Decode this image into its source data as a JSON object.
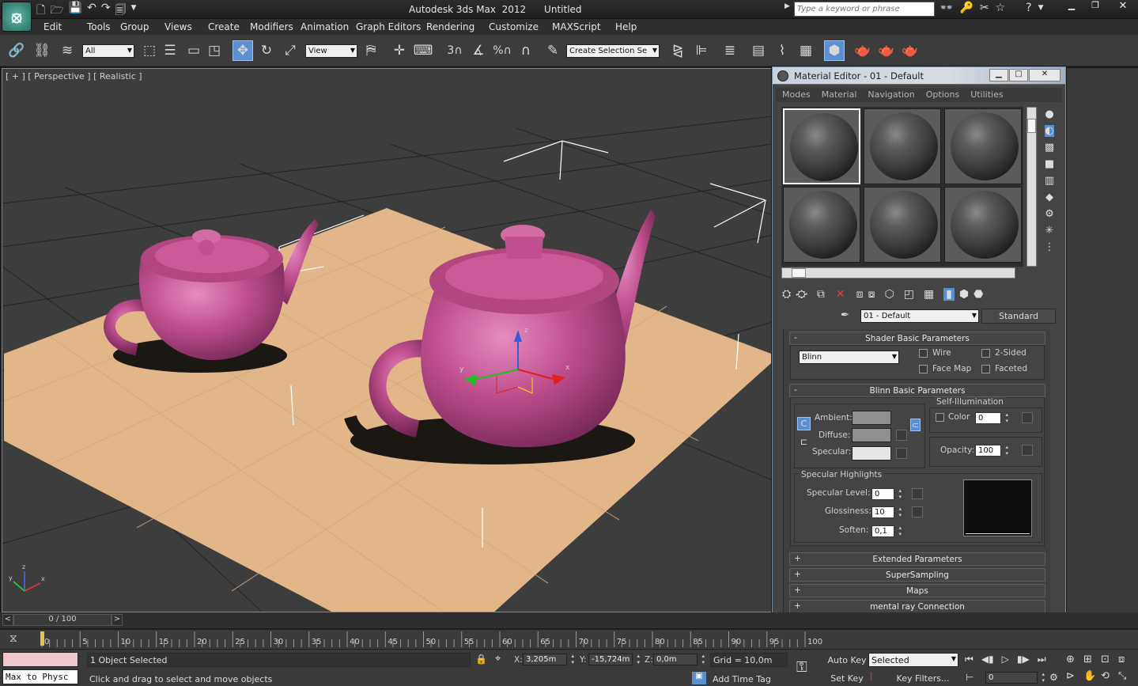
{
  "title_bar": {
    "title": "Autodesk 3ds Max  2012      Untitled",
    "search_placeholder": "Type a keyword or phrase"
  },
  "menu": [
    "Edit",
    "Tools",
    "Group",
    "Views",
    "Create",
    "Modifiers",
    "Animation",
    "Graph Editors",
    "Rendering",
    "Customize",
    "MAXScript",
    "Help"
  ],
  "toolbar": {
    "selection_filter": "All",
    "ref_coord": "View",
    "named_selection": "Create Selection Se",
    "snap_angle": "3",
    "snap_percent": "%"
  },
  "viewport": {
    "label": "[ + ] [ Perspective ] [ Realistic ]"
  },
  "material_editor": {
    "title": "Material Editor - 01 - Default",
    "menu": [
      "Modes",
      "Material",
      "Navigation",
      "Options",
      "Utilities"
    ],
    "material_name": "01 - Default",
    "material_type": "Standard",
    "shader": {
      "header": "Shader Basic Parameters",
      "type": "Blinn",
      "wire": "Wire",
      "two_sided": "2-Sided",
      "face_map": "Face Map",
      "faceted": "Faceted"
    },
    "blinn": {
      "header": "Blinn Basic Parameters",
      "self_illum": "Self-Illumination",
      "color": "Color",
      "color_value": "0",
      "ambient": "Ambient:",
      "diffuse": "Diffuse:",
      "specular": "Specular:",
      "opacity": "Opacity:",
      "opacity_value": "100"
    },
    "highlights": {
      "header": "Specular Highlights",
      "level_label": "Specular Level:",
      "level": "0",
      "gloss_label": "Glossiness:",
      "gloss": "10",
      "soften_label": "Soften:",
      "soften": "0,1"
    },
    "rollouts": [
      "Extended Parameters",
      "SuperSampling",
      "Maps",
      "mental ray Connection"
    ],
    "colors": {
      "ambient": "#8f8f8f",
      "diffuse": "#8f8f8f",
      "specular": "#e6e6e6"
    }
  },
  "timeline": {
    "frame_display": "0 / 100",
    "ticks": [
      "0",
      "5",
      "10",
      "15",
      "20",
      "25",
      "30",
      "35",
      "40",
      "45",
      "50",
      "55",
      "60",
      "65",
      "70",
      "75",
      "80",
      "85",
      "90",
      "95",
      "100"
    ]
  },
  "status": {
    "selected": "1 Object Selected",
    "prompt": "Click and drag to select and move objects",
    "maxscript": "Max to Physc",
    "x_label": "X:",
    "x": "3,205m",
    "y_label": "Y:",
    "y": "-15,724m",
    "z_label": "Z:",
    "z": "0,0m",
    "grid": "Grid = 10,0m",
    "add_time_tag": "Add Time Tag",
    "auto_key": "Auto Key",
    "set_key": "Set Key",
    "key_mode": "Selected",
    "key_filters": "Key Filters...",
    "current_frame": "0"
  },
  "scene_colors": {
    "teapot": "#c0508f",
    "floor": "#e3b68a",
    "viewport_bg": "#3d3d3d"
  }
}
